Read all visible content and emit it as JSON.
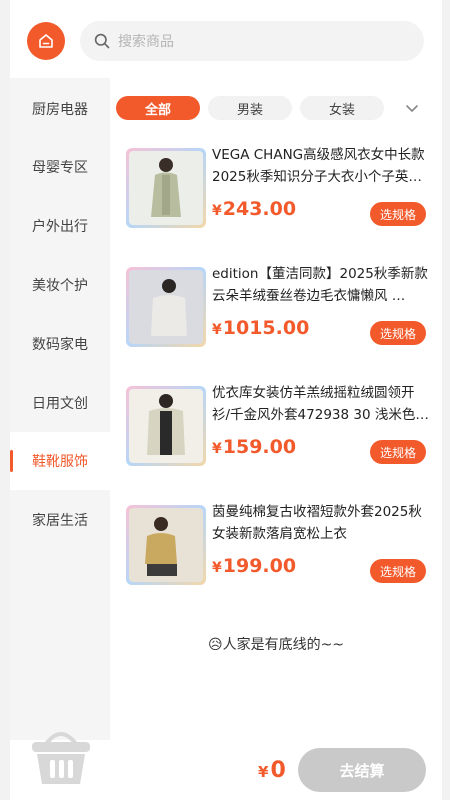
{
  "search": {
    "placeholder": "搜索商品"
  },
  "sidebar": {
    "items": [
      {
        "label": "厨房电器"
      },
      {
        "label": "母婴专区"
      },
      {
        "label": "户外出行"
      },
      {
        "label": "美妆个护"
      },
      {
        "label": "数码家电"
      },
      {
        "label": "日用文创"
      },
      {
        "label": "鞋靴服饰"
      },
      {
        "label": "家居生活"
      }
    ],
    "active_index": 6
  },
  "tabs": [
    {
      "label": "全部"
    },
    {
      "label": "男装"
    },
    {
      "label": "女装"
    }
  ],
  "products": [
    {
      "title": "VEGA CHANG高级感风衣女中长款2025秋季知识分子大衣小个子英…",
      "currency": "¥",
      "price": "243.00",
      "button": "选规格"
    },
    {
      "title": "edition【董洁同款】2025秋季新款云朵羊绒蚕丝卷边毛衣慵懒风 …",
      "currency": "¥",
      "price": "1015.00",
      "button": "选规格"
    },
    {
      "title": "优衣库女装仿羊羔绒摇粒绒圆领开衫/千金风外套472938 30 浅米色…",
      "currency": "¥",
      "price": "159.00",
      "button": "选规格"
    },
    {
      "title": "茵曼纯棉复古收褶短款外套2025秋女装新款落肩宽松上衣",
      "currency": "¥",
      "price": "199.00",
      "button": "选规格"
    }
  ],
  "bottom_note": "😥人家是有底线的~~",
  "cart": {
    "currency": "¥",
    "total": "0",
    "checkout_label": "去结算"
  },
  "colors": {
    "accent": "#f25a2c",
    "disabled": "#c9c9c9"
  }
}
